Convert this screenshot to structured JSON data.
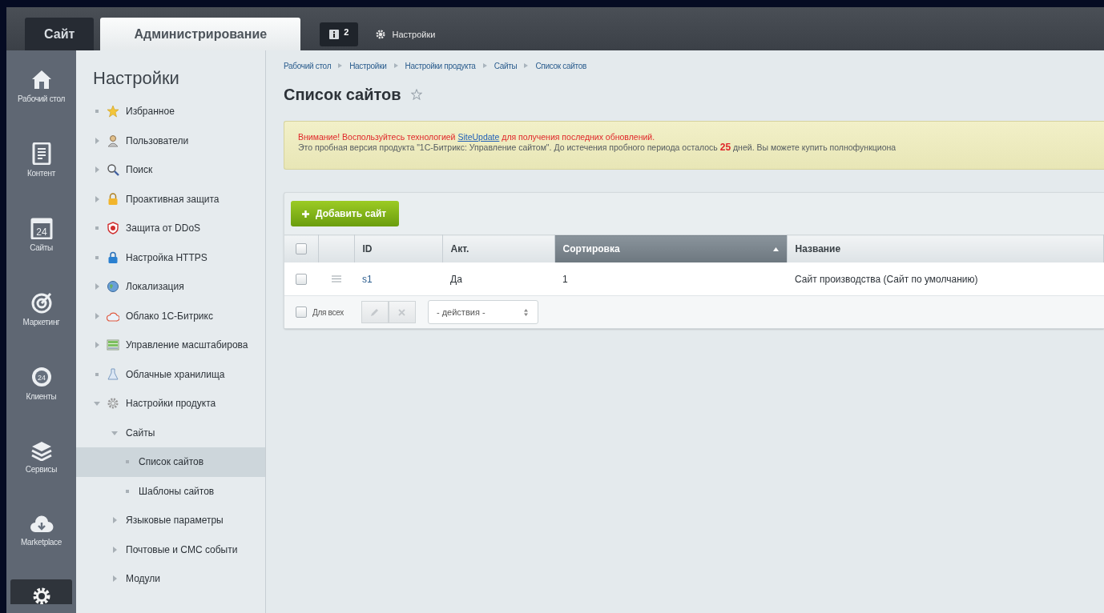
{
  "top_bar": {
    "tabs": [
      {
        "label": "Сайт",
        "selected": false
      },
      {
        "label": "Администрирование",
        "selected": true
      }
    ],
    "notifications": {
      "count": "2"
    },
    "settings_link": {
      "label": "Настройки"
    }
  },
  "rail": [
    {
      "label": "Рабочий стол",
      "selected": false
    },
    {
      "label": "Контент",
      "selected": false
    },
    {
      "label": "Сайты",
      "icon_text": "24",
      "selected": false
    },
    {
      "label": "Маркетинг",
      "selected": false
    },
    {
      "label": "Клиенты",
      "icon_text": "24",
      "selected": false
    },
    {
      "label": "Сервисы",
      "selected": false
    },
    {
      "label": "Marketplace",
      "selected": false
    }
  ],
  "rail_settings": {
    "selected": true
  },
  "sidebar": {
    "title": "Настройки",
    "items": [
      {
        "label": "Избранное",
        "kind": "leaf",
        "selected": false
      },
      {
        "label": "Пользователи",
        "kind": "folder",
        "expanded": false,
        "selected": false
      },
      {
        "label": "Поиск",
        "kind": "folder",
        "expanded": false,
        "selected": false
      },
      {
        "label": "Проактивная защита",
        "kind": "folder",
        "expanded": false,
        "selected": false
      },
      {
        "label": "Защита от DDoS",
        "kind": "leaf",
        "selected": false
      },
      {
        "label": "Настройка HTTPS",
        "kind": "leaf",
        "selected": false
      },
      {
        "label": "Локализация",
        "kind": "folder",
        "expanded": false,
        "selected": false
      },
      {
        "label": "Облако 1С-Битрикс",
        "kind": "folder",
        "expanded": false,
        "selected": false
      },
      {
        "label": "Управление масштабирова",
        "kind": "folder",
        "expanded": false,
        "selected": false
      },
      {
        "label": "Облачные хранилища",
        "kind": "leaf",
        "selected": false
      },
      {
        "label": "Настройки продукта",
        "kind": "folder",
        "expanded": true,
        "selected": false,
        "children": [
          {
            "label": "Сайты",
            "kind": "folder",
            "expanded": true,
            "selected": false,
            "children": [
              {
                "label": "Список сайтов",
                "kind": "leaf",
                "selected": true
              },
              {
                "label": "Шаблоны сайтов",
                "kind": "leaf",
                "selected": false
              }
            ]
          },
          {
            "label": "Языковые параметры",
            "kind": "folder",
            "expanded": false,
            "selected": false
          },
          {
            "label": "Почтовые и СМС событи",
            "kind": "folder",
            "expanded": false,
            "selected": false
          },
          {
            "label": "Модули",
            "kind": "folder",
            "expanded": false,
            "selected": false
          }
        ]
      }
    ]
  },
  "breadcrumbs": [
    "Рабочий стол",
    "Настройки",
    "Настройки продукта",
    "Сайты",
    "Список сайтов"
  ],
  "page_title": "Список сайтов",
  "notice": {
    "before_link": "Внимание! Воспользуйтесь технологией",
    "link": "SiteUpdate",
    "after_link": "для получения последних обновлений.",
    "details": "Это пробная версия продукта \"1С-Битрикс: Управление сайтом\". До истечения пробного периода осталось **25** дней. Вы можете купить полнофункциона"
  },
  "add_button": "Добавить сайт",
  "table": {
    "select_all_checked": false,
    "columns": [
      {
        "label": "ID",
        "selected": false
      },
      {
        "label": "Акт.",
        "selected": false
      },
      {
        "label": "Сортировка",
        "selected": true
      },
      {
        "label": "Название",
        "selected": false
      }
    ],
    "rows": [
      {
        "checked": false,
        "cells": [
          "s1",
          "Да",
          "1",
          "Сайт производства (Сайт по умолчанию)"
        ]
      }
    ]
  },
  "footer": {
    "for_all": "Для всех",
    "for_all_checked": false,
    "actions_placeholder": "- действия -"
  }
}
